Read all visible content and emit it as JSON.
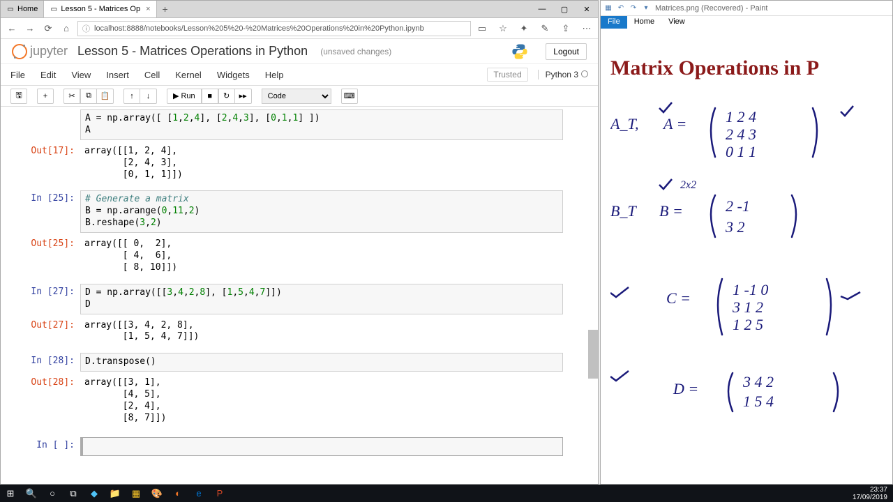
{
  "browser": {
    "tabs": [
      {
        "label": "Home"
      },
      {
        "label": "Lesson 5 - Matrices Op"
      }
    ],
    "url": "localhost:8888/notebooks/Lesson%205%20-%20Matrices%20Operations%20in%20Python.ipynb"
  },
  "jupyter": {
    "brand": "jupyter",
    "title": "Lesson 5 - Matrices Operations in Python",
    "autosave": "(unsaved changes)",
    "logout": "Logout",
    "menu": [
      "File",
      "Edit",
      "View",
      "Insert",
      "Cell",
      "Kernel",
      "Widgets",
      "Help"
    ],
    "trusted": "Trusted",
    "kernel": "Python 3",
    "run_label": "Run",
    "cell_type": "Code"
  },
  "cells": {
    "c0_in": "A = np.array([ [1,2,4], [2,4,3], [0,1,1] ])\nA",
    "c0_out_p": "Out[17]:",
    "c0_out": "array([[1, 2, 4],\n       [2, 4, 3],\n       [0, 1, 1]])",
    "c1_in_p": "In [25]:",
    "c1_in_comment": "# Generate a matrix",
    "c1_in_l2": "B = np.arange(0,11,2)",
    "c1_in_l3": "B.reshape(3,2)",
    "c1_out_p": "Out[25]:",
    "c1_out": "array([[ 0,  2],\n       [ 4,  6],\n       [ 8, 10]])",
    "c2_in_p": "In [27]:",
    "c2_in": "D = np.array([[3,4,2,8], [1,5,4,7]])\nD",
    "c2_out_p": "Out[27]:",
    "c2_out": "array([[3, 4, 2, 8],\n       [1, 5, 4, 7]])",
    "c3_in_p": "In [28]:",
    "c3_in": "D.transpose()",
    "c3_out_p": "Out[28]:",
    "c3_out": "array([[3, 1],\n       [4, 5],\n       [2, 4],\n       [8, 7]])",
    "c4_in_p": "In [ ]:"
  },
  "paint": {
    "title": "Matrices.png (Recovered) - Paint",
    "tabs": {
      "file": "File",
      "home": "Home",
      "view": "View"
    },
    "heading": "Matrix Operations in P"
  },
  "taskbar": {
    "time": "23:37",
    "date": "17/09/2019"
  }
}
